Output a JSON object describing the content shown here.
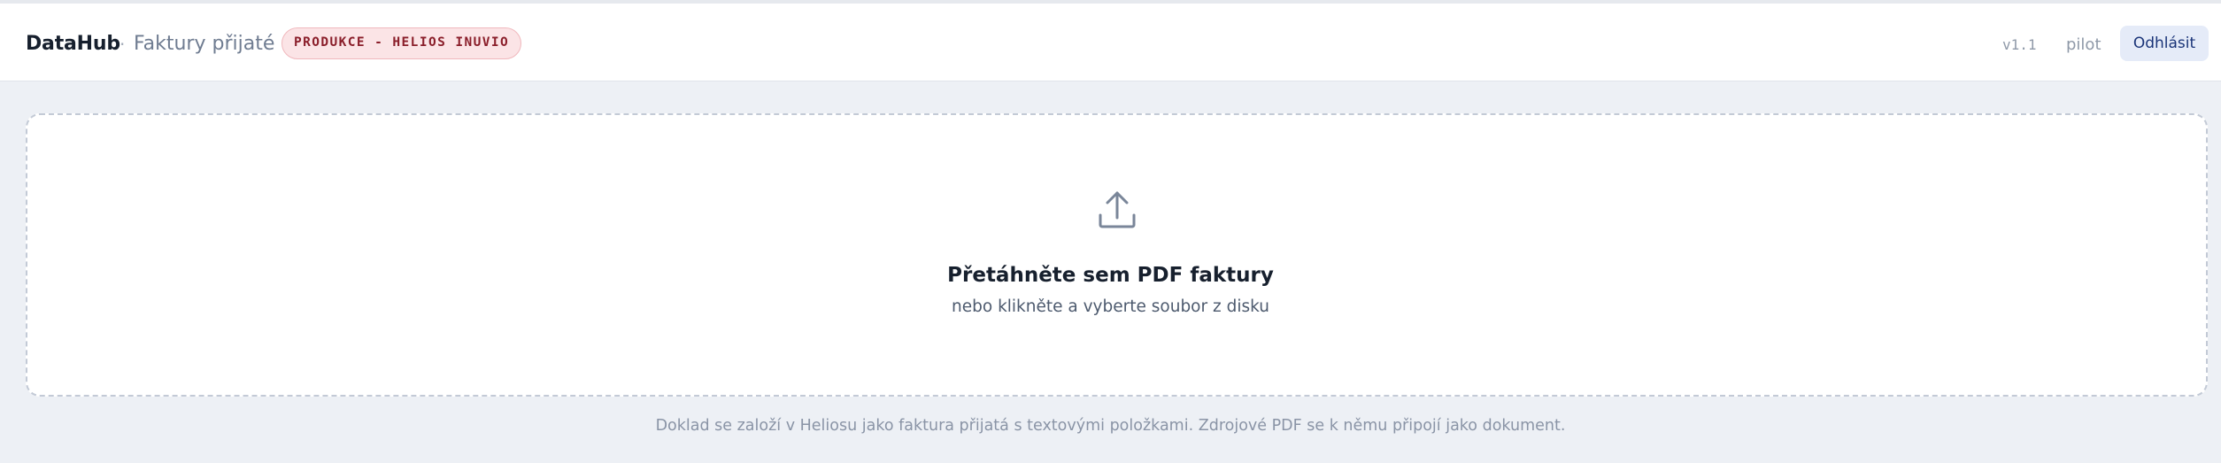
{
  "header": {
    "brand": "DataHub",
    "separator": "·",
    "page_title": "Faktury přijaté",
    "environment_badge": "PRODUKCE - HELIOS INUVIO",
    "version": "v1.1",
    "user": "pilot",
    "logout_label": "Odhlásit"
  },
  "dropzone": {
    "icon": "upload-icon",
    "title": "Přetáhněte sem PDF faktury",
    "subtitle": "nebo klikněte a vyberte soubor z disku"
  },
  "footnote": "Doklad se založí v Heliosu jako faktura přijatá s textovými položkami. Zdrojové PDF se k němu připojí jako dokument.",
  "colors": {
    "background": "#edf0f5",
    "badge_bg": "#fbe4e6",
    "badge_text": "#8a1e2a",
    "logout_bg": "#e5ebf8",
    "logout_text": "#1a3478"
  }
}
